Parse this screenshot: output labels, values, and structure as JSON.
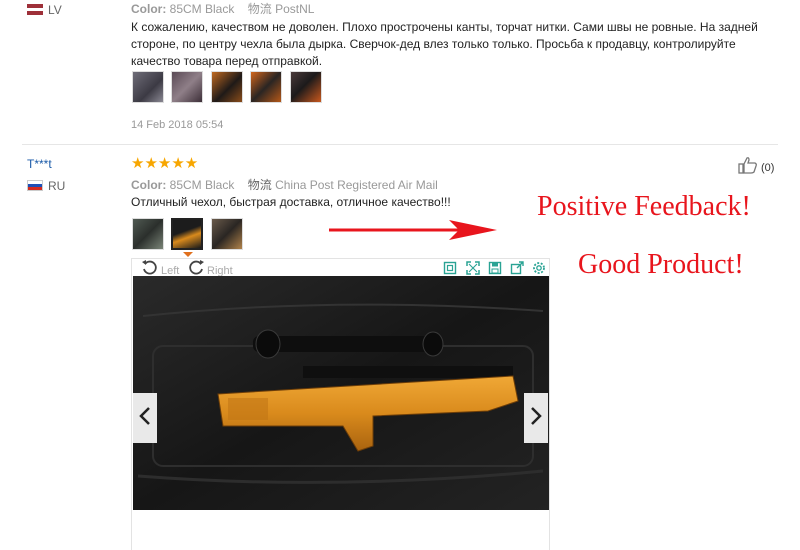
{
  "review1": {
    "country": "LV",
    "color_label": "Color:",
    "color_value": "85CM Black",
    "shipping_label": "物流",
    "shipping_value": "PostNL",
    "text": "К сожалению, качеством не доволен. Плохо прострочены канты, торчат нитки. Сами швы не ровные. На задней стороне, по центру чехла была дырка. Сверчок-дед влез только только. Просьба к продавцу, контролируйте качество товара перед отправкой.",
    "date": "14 Feb 2018 05:54"
  },
  "review2": {
    "user": "T***t",
    "country": "RU",
    "stars": "★★★★★",
    "color_label": "Color:",
    "color_value": "85CM Black",
    "shipping_label": "物流",
    "shipping_value": "China Post Registered Air Mail",
    "text": "Отличный чехол, быстрая доставка, отличное качество!!!",
    "helpful_count": "(0)",
    "rotate_left": "Left",
    "rotate_right": "Right"
  },
  "callouts": {
    "line1": "Positive Feedback!",
    "line2": "Good Product!"
  },
  "colors": {
    "accent_red": "#e8151d",
    "star": "#f7a600",
    "toolbar_green": "#2aa394",
    "user_blue": "#1a5aa8"
  }
}
